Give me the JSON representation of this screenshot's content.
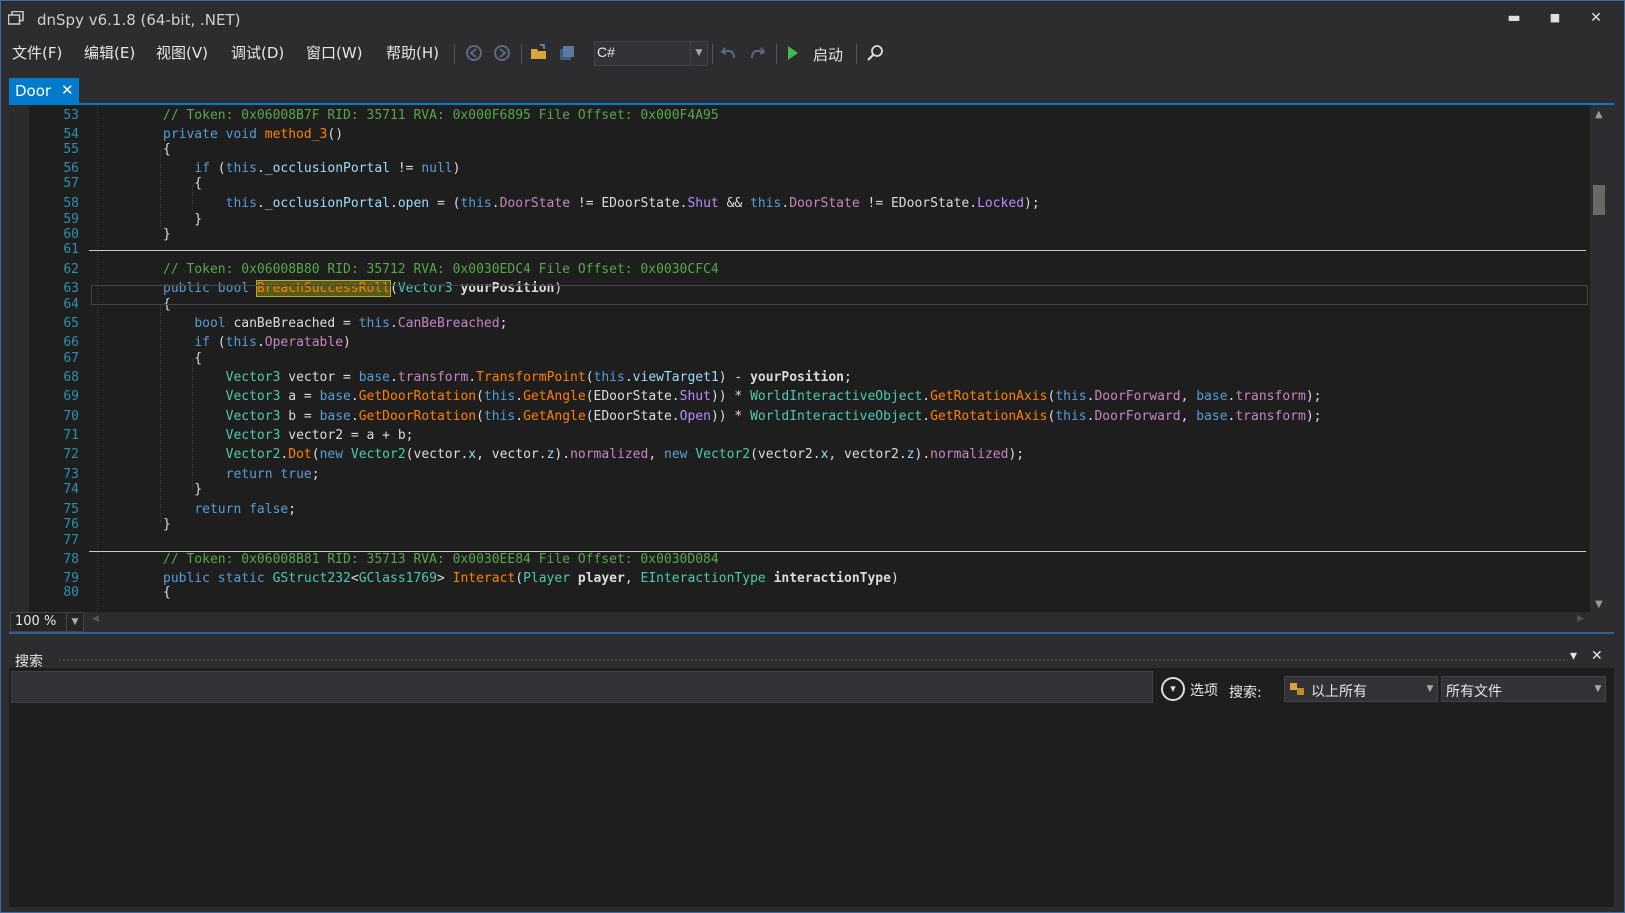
{
  "window": {
    "title": "dnSpy v6.1.8 (64-bit, .NET)",
    "minimize": "▬",
    "maximize": "■",
    "close": "✕"
  },
  "menu": [
    "文件(F)",
    "编辑(E)",
    "视图(V)",
    "调试(D)",
    "窗口(W)",
    "帮助(H)"
  ],
  "toolbar": {
    "language": "C#",
    "start_label": "启动"
  },
  "tab": {
    "label": "Door",
    "close": "✕"
  },
  "editor": {
    "zoom": "100 %",
    "lines": [
      {
        "n": "53",
        "tokens": [
          [
            "c-comment",
            "// Token: 0x06008B7F RID: 35711 RVA: 0x000F6895 File Offset: 0x000F4A95"
          ]
        ]
      },
      {
        "n": "54",
        "tokens": [
          [
            "c-kw",
            "private void "
          ],
          [
            "c-method",
            "method_3"
          ],
          [
            "c-plain",
            "()"
          ]
        ]
      },
      {
        "n": "55",
        "tokens": [
          [
            "c-plain",
            "{"
          ]
        ]
      },
      {
        "n": "56",
        "tokens": [
          [
            "c-plain",
            "    "
          ],
          [
            "c-kw",
            "if"
          ],
          [
            "c-plain",
            " ("
          ],
          [
            "c-kw",
            "this"
          ],
          [
            "c-plain",
            "."
          ],
          [
            "c-field",
            "_occlusionPortal"
          ],
          [
            "c-plain",
            " != "
          ],
          [
            "c-kw",
            "null"
          ],
          [
            "c-plain",
            ")"
          ]
        ]
      },
      {
        "n": "57",
        "tokens": [
          [
            "c-plain",
            "    {"
          ]
        ]
      },
      {
        "n": "58",
        "tokens": [
          [
            "c-plain",
            "        "
          ],
          [
            "c-kw",
            "this"
          ],
          [
            "c-plain",
            "."
          ],
          [
            "c-field",
            "_occlusionPortal"
          ],
          [
            "c-plain",
            "."
          ],
          [
            "c-field",
            "open"
          ],
          [
            "c-plain",
            " = ("
          ],
          [
            "c-kw",
            "this"
          ],
          [
            "c-plain",
            "."
          ],
          [
            "c-prop",
            "DoorState"
          ],
          [
            "c-plain",
            " != EDoorState."
          ],
          [
            "c-enumv",
            "Shut"
          ],
          [
            "c-plain",
            " && "
          ],
          [
            "c-kw",
            "this"
          ],
          [
            "c-plain",
            "."
          ],
          [
            "c-prop",
            "DoorState"
          ],
          [
            "c-plain",
            " != EDoorState."
          ],
          [
            "c-enumv",
            "Locked"
          ],
          [
            "c-plain",
            ");"
          ]
        ]
      },
      {
        "n": "59",
        "tokens": [
          [
            "c-plain",
            "    }"
          ]
        ]
      },
      {
        "n": "60",
        "tokens": [
          [
            "c-plain",
            "}"
          ]
        ]
      },
      {
        "n": "61",
        "tokens": []
      },
      {
        "n": "62",
        "tokens": [
          [
            "c-comment",
            "// Token: 0x06008B80 RID: 35712 RVA: 0x0030EDC4 File Offset: 0x0030CFC4"
          ]
        ]
      },
      {
        "n": "63",
        "tokens": [
          [
            "c-kw",
            "public bool "
          ],
          [
            "hl",
            "BreachSuccessRoll"
          ],
          [
            "c-plain",
            "("
          ],
          [
            "c-type",
            "Vector3"
          ],
          [
            "c-plain",
            " "
          ],
          [
            "c-param",
            "yourPosition"
          ],
          [
            "c-plain",
            ")"
          ]
        ]
      },
      {
        "n": "64",
        "tokens": [
          [
            "c-plain",
            "{"
          ]
        ]
      },
      {
        "n": "65",
        "tokens": [
          [
            "c-plain",
            "    "
          ],
          [
            "c-kw",
            "bool"
          ],
          [
            "c-plain",
            " canBeBreached = "
          ],
          [
            "c-kw",
            "this"
          ],
          [
            "c-plain",
            "."
          ],
          [
            "c-prop",
            "CanBeBreached"
          ],
          [
            "c-plain",
            ";"
          ]
        ]
      },
      {
        "n": "66",
        "tokens": [
          [
            "c-plain",
            "    "
          ],
          [
            "c-kw",
            "if"
          ],
          [
            "c-plain",
            " ("
          ],
          [
            "c-kw",
            "this"
          ],
          [
            "c-plain",
            "."
          ],
          [
            "c-prop",
            "Operatable"
          ],
          [
            "c-plain",
            ")"
          ]
        ]
      },
      {
        "n": "67",
        "tokens": [
          [
            "c-plain",
            "    {"
          ]
        ]
      },
      {
        "n": "68",
        "tokens": [
          [
            "c-plain",
            "        "
          ],
          [
            "c-type",
            "Vector3"
          ],
          [
            "c-plain",
            " vector = "
          ],
          [
            "c-kw",
            "base"
          ],
          [
            "c-plain",
            "."
          ],
          [
            "c-prop",
            "transform"
          ],
          [
            "c-plain",
            "."
          ],
          [
            "c-method",
            "TransformPoint"
          ],
          [
            "c-plain",
            "("
          ],
          [
            "c-kw",
            "this"
          ],
          [
            "c-plain",
            "."
          ],
          [
            "c-field",
            "viewTarget1"
          ],
          [
            "c-plain",
            ") - "
          ],
          [
            "c-param",
            "yourPosition"
          ],
          [
            "c-plain",
            ";"
          ]
        ]
      },
      {
        "n": "69",
        "tokens": [
          [
            "c-plain",
            "        "
          ],
          [
            "c-type",
            "Vector3"
          ],
          [
            "c-plain",
            " a = "
          ],
          [
            "c-kw",
            "base"
          ],
          [
            "c-plain",
            "."
          ],
          [
            "c-method",
            "GetDoorRotation"
          ],
          [
            "c-plain",
            "("
          ],
          [
            "c-kw",
            "this"
          ],
          [
            "c-plain",
            "."
          ],
          [
            "c-method",
            "GetAngle"
          ],
          [
            "c-plain",
            "(EDoorState."
          ],
          [
            "c-enumv",
            "Shut"
          ],
          [
            "c-plain",
            ")) * "
          ],
          [
            "c-type",
            "WorldInteractiveObject"
          ],
          [
            "c-plain",
            "."
          ],
          [
            "c-method",
            "GetRotationAxis"
          ],
          [
            "c-plain",
            "("
          ],
          [
            "c-kw",
            "this"
          ],
          [
            "c-plain",
            "."
          ],
          [
            "c-prop",
            "DoorForward"
          ],
          [
            "c-plain",
            ", "
          ],
          [
            "c-kw",
            "base"
          ],
          [
            "c-plain",
            "."
          ],
          [
            "c-prop",
            "transform"
          ],
          [
            "c-plain",
            ");"
          ]
        ]
      },
      {
        "n": "70",
        "tokens": [
          [
            "c-plain",
            "        "
          ],
          [
            "c-type",
            "Vector3"
          ],
          [
            "c-plain",
            " b = "
          ],
          [
            "c-kw",
            "base"
          ],
          [
            "c-plain",
            "."
          ],
          [
            "c-method",
            "GetDoorRotation"
          ],
          [
            "c-plain",
            "("
          ],
          [
            "c-kw",
            "this"
          ],
          [
            "c-plain",
            "."
          ],
          [
            "c-method",
            "GetAngle"
          ],
          [
            "c-plain",
            "(EDoorState."
          ],
          [
            "c-enumv",
            "Open"
          ],
          [
            "c-plain",
            ")) * "
          ],
          [
            "c-type",
            "WorldInteractiveObject"
          ],
          [
            "c-plain",
            "."
          ],
          [
            "c-method",
            "GetRotationAxis"
          ],
          [
            "c-plain",
            "("
          ],
          [
            "c-kw",
            "this"
          ],
          [
            "c-plain",
            "."
          ],
          [
            "c-prop",
            "DoorForward"
          ],
          [
            "c-plain",
            ", "
          ],
          [
            "c-kw",
            "base"
          ],
          [
            "c-plain",
            "."
          ],
          [
            "c-prop",
            "transform"
          ],
          [
            "c-plain",
            ");"
          ]
        ]
      },
      {
        "n": "71",
        "tokens": [
          [
            "c-plain",
            "        "
          ],
          [
            "c-type",
            "Vector3"
          ],
          [
            "c-plain",
            " vector2 = a + b;"
          ]
        ]
      },
      {
        "n": "72",
        "tokens": [
          [
            "c-plain",
            "        "
          ],
          [
            "c-type",
            "Vector2"
          ],
          [
            "c-plain",
            "."
          ],
          [
            "c-method",
            "Dot"
          ],
          [
            "c-plain",
            "("
          ],
          [
            "c-kw",
            "new"
          ],
          [
            "c-plain",
            " "
          ],
          [
            "c-type",
            "Vector2"
          ],
          [
            "c-plain",
            "(vector."
          ],
          [
            "c-field",
            "x"
          ],
          [
            "c-plain",
            ", vector."
          ],
          [
            "c-field",
            "z"
          ],
          [
            "c-plain",
            ")."
          ],
          [
            "c-prop",
            "normalized"
          ],
          [
            "c-plain",
            ", "
          ],
          [
            "c-kw",
            "new"
          ],
          [
            "c-plain",
            " "
          ],
          [
            "c-type",
            "Vector2"
          ],
          [
            "c-plain",
            "(vector2."
          ],
          [
            "c-field",
            "x"
          ],
          [
            "c-plain",
            ", vector2."
          ],
          [
            "c-field",
            "z"
          ],
          [
            "c-plain",
            ")."
          ],
          [
            "c-prop",
            "normalized"
          ],
          [
            "c-plain",
            ");"
          ]
        ]
      },
      {
        "n": "73",
        "tokens": [
          [
            "c-plain",
            "        "
          ],
          [
            "c-kw",
            "return true"
          ],
          [
            "c-plain",
            ";"
          ]
        ]
      },
      {
        "n": "74",
        "tokens": [
          [
            "c-plain",
            "    }"
          ]
        ]
      },
      {
        "n": "75",
        "tokens": [
          [
            "c-plain",
            "    "
          ],
          [
            "c-kw",
            "return false"
          ],
          [
            "c-plain",
            ";"
          ]
        ]
      },
      {
        "n": "76",
        "tokens": [
          [
            "c-plain",
            "}"
          ]
        ]
      },
      {
        "n": "77",
        "tokens": []
      },
      {
        "n": "78",
        "tokens": [
          [
            "c-comment",
            "// Token: 0x06008B81 RID: 35713 RVA: 0x0030EE84 File Offset: 0x0030D084"
          ]
        ]
      },
      {
        "n": "79",
        "tokens": [
          [
            "c-kw",
            "public static "
          ],
          [
            "c-type",
            "GStruct232"
          ],
          [
            "c-plain",
            "<"
          ],
          [
            "c-type",
            "GClass1769"
          ],
          [
            "c-plain",
            "> "
          ],
          [
            "c-method",
            "Interact"
          ],
          [
            "c-plain",
            "("
          ],
          [
            "c-type",
            "Player"
          ],
          [
            "c-plain",
            " "
          ],
          [
            "c-param",
            "player"
          ],
          [
            "c-plain",
            ", "
          ],
          [
            "c-type",
            "EInteractionType"
          ],
          [
            "c-plain",
            " "
          ],
          [
            "c-param",
            "interactionType"
          ],
          [
            "c-plain",
            ")"
          ]
        ]
      },
      {
        "n": "80",
        "tokens": [
          [
            "c-plain",
            "{"
          ]
        ]
      }
    ]
  },
  "search_panel": {
    "title": "搜索",
    "dropdown_btn": "▾",
    "close_btn": "✕",
    "options_label": "选项",
    "search_label": "搜索:",
    "scope": "以上所有",
    "files": "所有文件"
  },
  "colors": {
    "accent": "#007acc",
    "background": "#2d2d30",
    "editor_bg": "#1e1e1e"
  }
}
